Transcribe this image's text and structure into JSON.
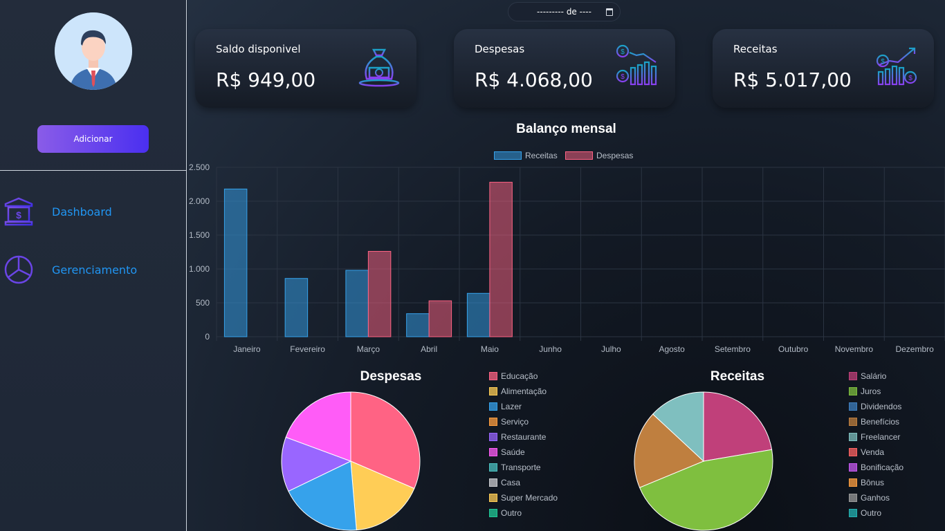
{
  "sidebar": {
    "add_button_label": "Adicionar",
    "nav": [
      {
        "label": "Dashboard",
        "icon": "bank-icon"
      },
      {
        "label": "Gerenciamento",
        "icon": "pie-chart-icon"
      }
    ]
  },
  "header": {
    "date_value": "--------- de ----"
  },
  "cards": [
    {
      "title": "Saldo disponivel",
      "value": "R$ 949,00",
      "icon": "money-bag-icon"
    },
    {
      "title": "Despesas",
      "value": "R$ 4.068,00",
      "icon": "expenses-chart-icon"
    },
    {
      "title": "Receitas",
      "value": "R$ 5.017,00",
      "icon": "income-chart-icon"
    }
  ],
  "colors": {
    "accent": "#2196f3",
    "receitas": "#36a2eb",
    "despesas": "#ff6384"
  },
  "chart_data": [
    {
      "type": "bar",
      "title": "Balanço mensal",
      "categories": [
        "Janeiro",
        "Fevereiro",
        "Março",
        "Abril",
        "Maio",
        "Junho",
        "Julho",
        "Agosto",
        "Setembro",
        "Outubro",
        "Novembro",
        "Dezembro"
      ],
      "series": [
        {
          "name": "Receitas",
          "color": "#36a2eb",
          "values": [
            2180,
            860,
            980,
            340,
            640,
            0,
            0,
            0,
            0,
            0,
            0,
            0
          ]
        },
        {
          "name": "Despesas",
          "color": "#ff6384",
          "values": [
            0,
            0,
            1260,
            530,
            2280,
            0,
            0,
            0,
            0,
            0,
            0,
            0
          ]
        }
      ],
      "yticks": [
        "0",
        "500",
        "1.000",
        "1.500",
        "2.000",
        "2.500"
      ],
      "ylim": [
        0,
        2500
      ],
      "grid": true,
      "legend": "top"
    },
    {
      "type": "pie",
      "title": "Despesas",
      "labels": [
        "Educação",
        "Alimentação",
        "Lazer",
        "Serviço",
        "Restaurante",
        "Saúde",
        "Transporte",
        "Casa",
        "Super Mercado",
        "Outro"
      ],
      "colors": [
        "#ff6384",
        "#ffcd56",
        "#36a2eb",
        "#ff9f40",
        "#9966ff",
        "#ff5cf7",
        "#4bc0c0",
        "#c9cbcf",
        "#ffcd56",
        "#20c997"
      ],
      "values": [
        1280,
        700,
        780,
        0,
        520,
        788,
        0,
        0,
        0,
        0
      ],
      "legend": "right"
    },
    {
      "type": "pie",
      "title": "Receitas",
      "labels": [
        "Salário",
        "Juros",
        "Dividendos",
        "Benefícios",
        "Freelancer",
        "Venda",
        "Bonificação",
        "Bônus",
        "Ganhos",
        "Outro"
      ],
      "colors": [
        "#c0407a",
        "#7fbf3f",
        "#3f7fbf",
        "#bf7f3f",
        "#7fbfbf",
        "#ff6363",
        "#c759f0",
        "#ff9f40",
        "#9a9a9a",
        "#23b2b2"
      ],
      "values": [
        1120,
        2330,
        0,
        910,
        657,
        0,
        0,
        0,
        0,
        0
      ],
      "legend": "right"
    }
  ]
}
